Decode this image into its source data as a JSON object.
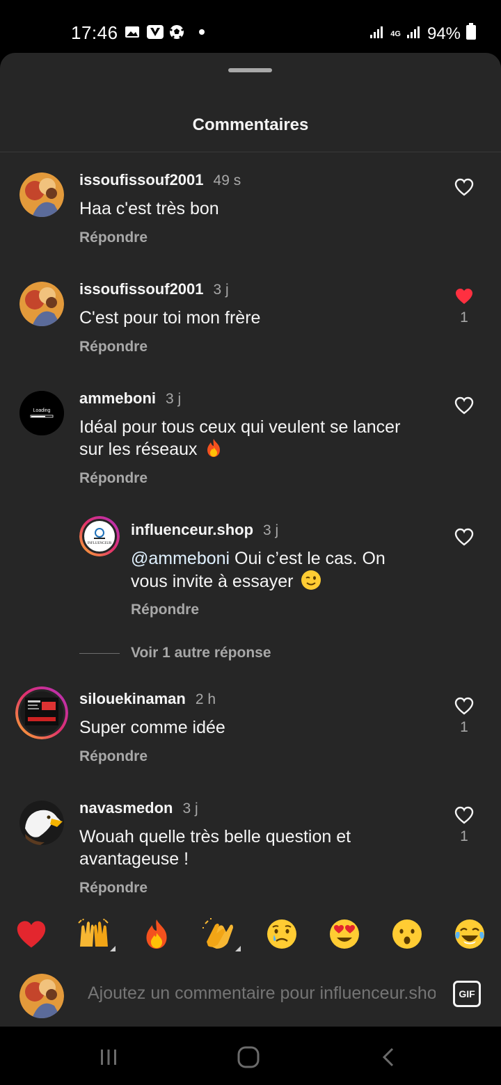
{
  "status_bar": {
    "time": "17:46",
    "network": "4G",
    "battery": "94%",
    "icons": [
      "gallery-icon",
      "v-app-icon",
      "soccer-icon",
      "signal-icon",
      "battery-icon"
    ]
  },
  "sheet": {
    "title": "Commentaires"
  },
  "comments": [
    {
      "user": "issoufissouf2001",
      "time": "49 s",
      "text": "Haa c'est très bon",
      "reply_label": "Répondre",
      "liked": false,
      "like_count": ""
    },
    {
      "user": "issoufissouf2001",
      "time": "3 j",
      "text": "C'est pour toi mon frère",
      "reply_label": "Répondre",
      "liked": true,
      "like_count": "1"
    },
    {
      "user": "ammeboni",
      "time": "3 j",
      "text_line1": "Idéal pour tous ceux qui veulent se lancer",
      "text_line2": "sur les réseaux",
      "emoji": "fire",
      "reply_label": "Répondre",
      "liked": false,
      "like_count": "",
      "avatar_text": "Loading"
    },
    {
      "user": "influenceur.shop",
      "time": "3 j",
      "mention": "@ammeboni",
      "text_line1": " Oui c’est le cas. On",
      "text_line2": "vous invite à essayer",
      "emoji": "wink",
      "reply_label": "Répondre",
      "liked": false,
      "like_count": "",
      "avatar_text": "INFLUENCEUR"
    },
    {
      "user": "silouekinaman",
      "time": "2 h",
      "text": "Super comme idée",
      "reply_label": "Répondre",
      "liked": false,
      "like_count": "1"
    },
    {
      "user": "navasmedon",
      "time": "3 j",
      "text_line1": "Wouah quelle très belle question et",
      "text_line2": "avantageuse !",
      "reply_label": "Répondre",
      "liked": false,
      "like_count": "1"
    }
  ],
  "more_replies": "Voir 1 autre réponse",
  "emoji_bar": [
    "red-heart",
    "raising-hands",
    "fire",
    "clapping-hands",
    "crying-face",
    "heart-eyes-face",
    "surprised-face",
    "tears-of-joy-face"
  ],
  "composer": {
    "placeholder": "Ajoutez un commentaire pour influenceur.shop...",
    "gif_label": "GIF"
  },
  "nav": [
    "recents-icon",
    "home-icon",
    "back-icon"
  ],
  "colors": {
    "sheet_bg": "#262626",
    "text_primary": "#f5f5f5",
    "text_secondary": "#a8a8a8",
    "like_red": "#ff3040"
  }
}
